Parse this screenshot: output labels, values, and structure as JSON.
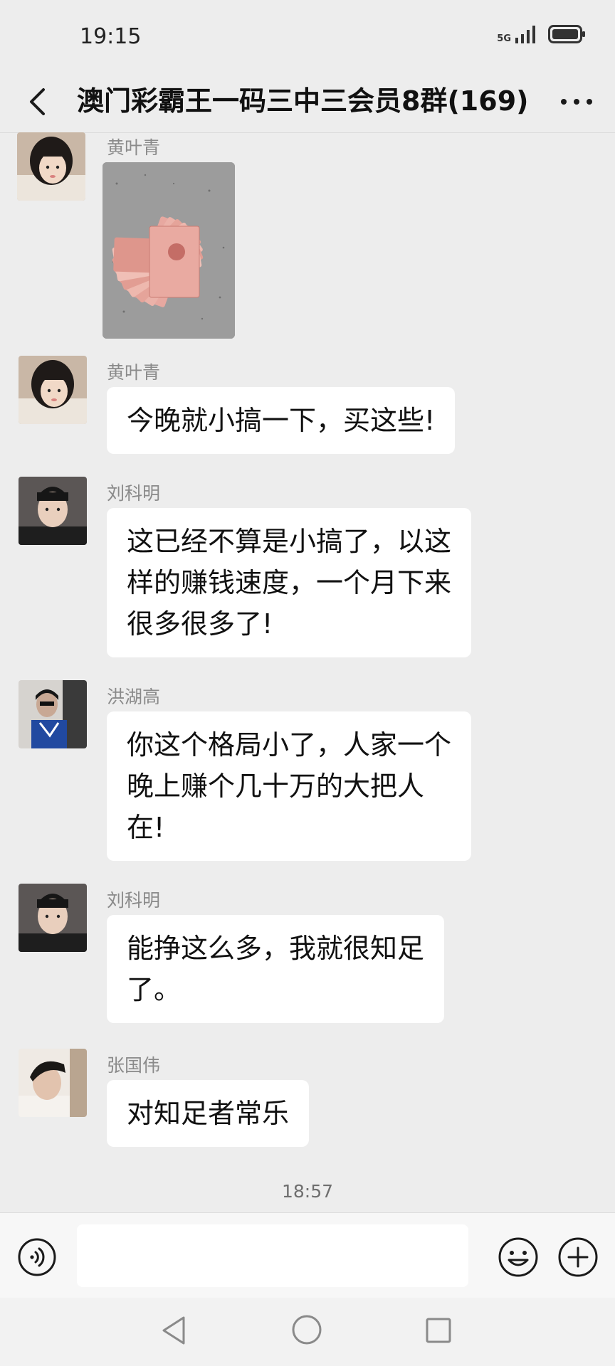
{
  "status_bar": {
    "time": "19:15",
    "network": "5G"
  },
  "header": {
    "title": "澳门彩霸王一码三中三会员8群(169)"
  },
  "messages": [
    {
      "sender": "黄叶青",
      "type": "image",
      "icon": "money-photo"
    },
    {
      "sender": "黄叶青",
      "type": "text",
      "lines": [
        "今晚就小搞一下，买这些!"
      ]
    },
    {
      "sender": "刘科明",
      "type": "text",
      "lines": [
        "这已经不算是小搞了，以这",
        "样的赚钱速度，一个月下来",
        "很多很多了!"
      ]
    },
    {
      "sender": "洪湖高",
      "type": "text",
      "lines": [
        "你这个格局小了，人家一个",
        "晚上赚个几十万的大把人",
        "在!"
      ]
    },
    {
      "sender": "刘科明",
      "type": "text",
      "lines": [
        "能挣这么多，我就很知足",
        "了。"
      ]
    },
    {
      "sender": "张国伟",
      "type": "text",
      "lines": [
        "对知足者常乐"
      ]
    }
  ],
  "timestamp": "18:57",
  "input": {
    "value": "",
    "placeholder": ""
  },
  "icons": {
    "back": "chevron-left-icon",
    "more": "more-horizontal-icon",
    "voice": "voice-input-icon",
    "emoji": "emoji-icon",
    "plus": "plus-icon"
  },
  "colors": {
    "background": "#ededed",
    "bubble": "#ffffff",
    "sender_name": "#8a8a8a"
  }
}
